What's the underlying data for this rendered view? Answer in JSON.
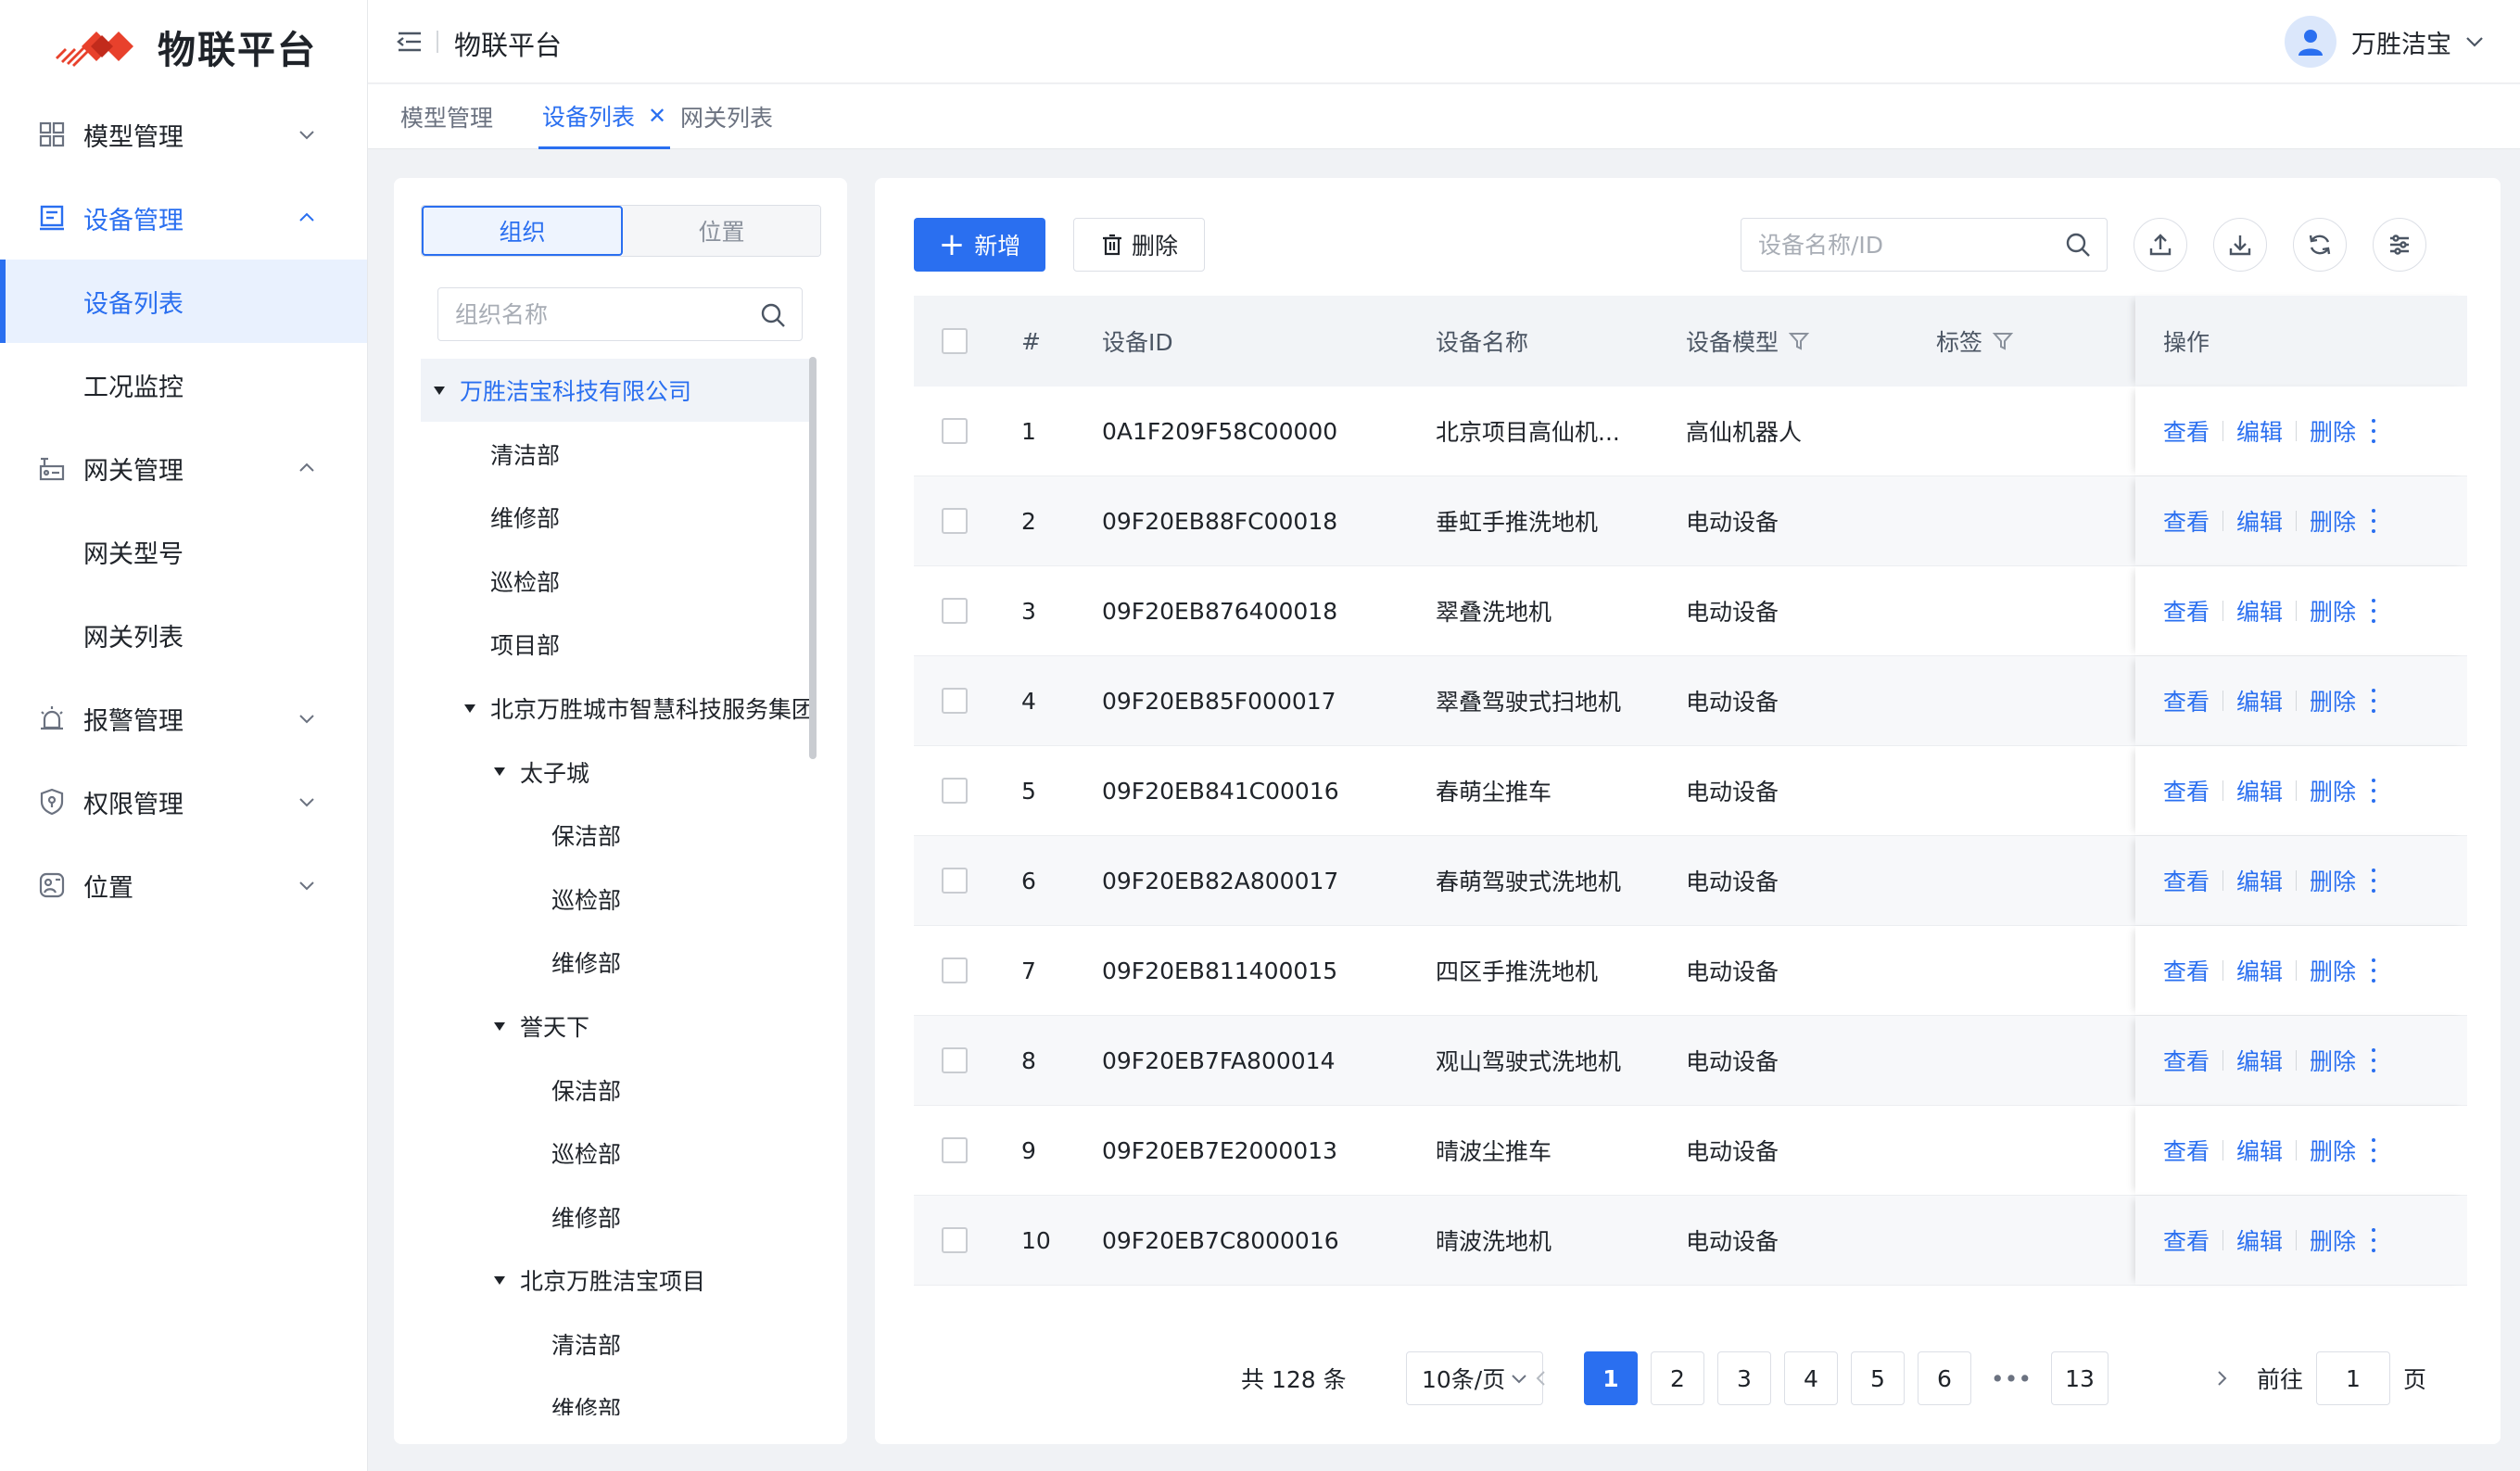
{
  "app": {
    "logo_text": "物联平台",
    "header_title": "物联平台"
  },
  "user": {
    "name": "万胜洁宝"
  },
  "sidebar": {
    "items": [
      {
        "label": "模型管理",
        "icon": "grid-icon"
      },
      {
        "label": "设备管理",
        "icon": "device-icon",
        "expanded": true
      },
      {
        "label": "设备列表",
        "sub": true,
        "selected": true
      },
      {
        "label": "工况监控",
        "sub": true
      },
      {
        "label": "网关管理",
        "icon": "gateway-icon",
        "expanded": true
      },
      {
        "label": "网关型号",
        "sub": true
      },
      {
        "label": "网关列表",
        "sub": true
      },
      {
        "label": "报警管理",
        "icon": "alarm-icon"
      },
      {
        "label": "权限管理",
        "icon": "shield-icon"
      },
      {
        "label": "位置",
        "icon": "location-icon"
      }
    ]
  },
  "tabs": [
    {
      "label": "模型管理"
    },
    {
      "label": "设备列表",
      "active": true
    },
    {
      "label": "网关列表"
    }
  ],
  "org_panel": {
    "segments": [
      "组织",
      "位置"
    ],
    "search_placeholder": "组织名称",
    "tree": [
      {
        "label": "万胜洁宝科技有限公司",
        "level": 0,
        "expanded": true,
        "selected": true
      },
      {
        "label": "清洁部",
        "level": 1
      },
      {
        "label": "维修部",
        "level": 1
      },
      {
        "label": "巡检部",
        "level": 1
      },
      {
        "label": "项目部",
        "level": 1
      },
      {
        "label": "北京万胜城市智慧科技服务集团",
        "level": 1,
        "expanded": true
      },
      {
        "label": "太子城",
        "level": 2,
        "expanded": true
      },
      {
        "label": "保洁部",
        "level": 3
      },
      {
        "label": "巡检部",
        "level": 3
      },
      {
        "label": "维修部",
        "level": 3
      },
      {
        "label": "誉天下",
        "level": 2,
        "expanded": true
      },
      {
        "label": "保洁部",
        "level": 3
      },
      {
        "label": "巡检部",
        "level": 3
      },
      {
        "label": "维修部",
        "level": 3
      },
      {
        "label": "北京万胜洁宝项目",
        "level": 2,
        "expanded": true
      },
      {
        "label": "清洁部",
        "level": 3
      },
      {
        "label": "维修部",
        "level": 3
      }
    ]
  },
  "toolbar": {
    "add_label": "新增",
    "delete_label": "删除",
    "search_placeholder": "设备名称/ID"
  },
  "table": {
    "columns": [
      "#",
      "设备ID",
      "设备名称",
      "设备模型",
      "标签",
      "操作"
    ],
    "actions": [
      "查看",
      "编辑",
      "删除"
    ],
    "rows": [
      {
        "no": "1",
        "id": "0A1F209F58C00000",
        "name": "北京项目高仙机...",
        "model": "高仙机器人",
        "tag": ""
      },
      {
        "no": "2",
        "id": "09F20EB88FC00018",
        "name": "垂虹手推洗地机",
        "model": "电动设备",
        "tag": ""
      },
      {
        "no": "3",
        "id": "09F20EB876400018",
        "name": "翠叠洗地机",
        "model": "电动设备",
        "tag": ""
      },
      {
        "no": "4",
        "id": "09F20EB85F000017",
        "name": "翠叠驾驶式扫地机",
        "model": "电动设备",
        "tag": ""
      },
      {
        "no": "5",
        "id": "09F20EB841C00016",
        "name": "春萌尘推车",
        "model": "电动设备",
        "tag": ""
      },
      {
        "no": "6",
        "id": "09F20EB82A800017",
        "name": "春萌驾驶式洗地机",
        "model": "电动设备",
        "tag": ""
      },
      {
        "no": "7",
        "id": "09F20EB811400015",
        "name": "四区手推洗地机",
        "model": "电动设备",
        "tag": ""
      },
      {
        "no": "8",
        "id": "09F20EB7FA800014",
        "name": "观山驾驶式洗地机",
        "model": "电动设备",
        "tag": ""
      },
      {
        "no": "9",
        "id": "09F20EB7E2000013",
        "name": "晴波尘推车",
        "model": "电动设备",
        "tag": ""
      },
      {
        "no": "10",
        "id": "09F20EB7C8000016",
        "name": "晴波洗地机",
        "model": "电动设备",
        "tag": ""
      }
    ]
  },
  "pagination": {
    "total_text": "共 128 条",
    "page_size": "10条/页",
    "pages": [
      "1",
      "2",
      "3",
      "4",
      "5",
      "6",
      "•••",
      "13"
    ],
    "current": "1",
    "goto_label": "前往",
    "goto_value": "1",
    "page_unit": "页"
  },
  "colors": {
    "primary": "#2a6ff0",
    "bg": "#f0f2f5",
    "selected_bg": "#e9f1fe"
  }
}
